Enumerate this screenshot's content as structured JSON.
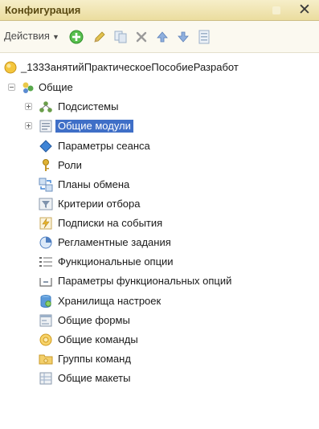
{
  "window": {
    "title": "Конфигурация",
    "close_glyph": "✕"
  },
  "toolbar": {
    "actions_label": "Действия",
    "buttons": [
      {
        "icon": "add-icon",
        "color": "#3cae3c"
      },
      {
        "icon": "edit-pencil-icon",
        "color": "#d4b23a"
      },
      {
        "icon": "copy-icon",
        "color": "#9bb0c8"
      },
      {
        "icon": "delete-icon",
        "color": "#8c8c8c"
      },
      {
        "icon": "move-up-icon",
        "color": "#6f93c9"
      },
      {
        "icon": "move-down-icon",
        "color": "#6f93c9"
      },
      {
        "icon": "properties-icon",
        "color": "#9bb0c8"
      }
    ]
  },
  "tree": {
    "root": {
      "label": "_133ЗанятийПрактическоеПособиеРазработ",
      "icon": "configuration-root-icon"
    },
    "common": {
      "label": "Общие",
      "icon": "common-group-icon"
    },
    "items": [
      {
        "label": "Подсистемы",
        "icon": "subsystems-icon",
        "expander": "plus"
      },
      {
        "label": "Общие модули",
        "icon": "common-modules-icon",
        "expander": "plus",
        "selected": true
      },
      {
        "label": "Параметры сеанса",
        "icon": "session-parameters-icon"
      },
      {
        "label": "Роли",
        "icon": "roles-icon"
      },
      {
        "label": "Планы обмена",
        "icon": "exchange-plans-icon"
      },
      {
        "label": "Критерии отбора",
        "icon": "filter-criteria-icon"
      },
      {
        "label": "Подписки на события",
        "icon": "event-subscriptions-icon"
      },
      {
        "label": "Регламентные задания",
        "icon": "scheduled-jobs-icon"
      },
      {
        "label": "Функциональные опции",
        "icon": "functional-options-icon"
      },
      {
        "label": "Параметры функциональных опций",
        "icon": "functional-option-parameters-icon"
      },
      {
        "label": "Хранилища настроек",
        "icon": "settings-storages-icon"
      },
      {
        "label": "Общие формы",
        "icon": "common-forms-icon"
      },
      {
        "label": "Общие команды",
        "icon": "common-commands-icon"
      },
      {
        "label": "Группы команд",
        "icon": "command-groups-icon"
      },
      {
        "label": "Общие макеты",
        "icon": "common-templates-icon"
      }
    ]
  },
  "colors": {
    "title_bg": "#ebdd9f",
    "selection": "#3f6fc7"
  }
}
